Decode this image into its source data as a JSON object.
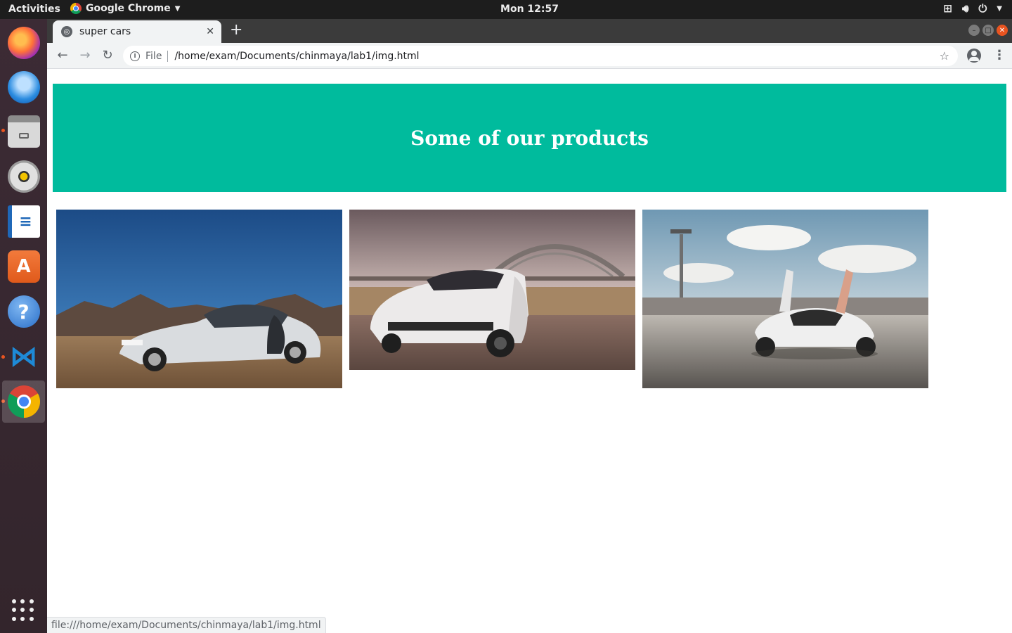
{
  "system_bar": {
    "activities": "Activities",
    "app_name": "Google Chrome",
    "clock": "Mon 12:57"
  },
  "dock": {
    "items": [
      {
        "name": "firefox-icon"
      },
      {
        "name": "thunderbird-icon"
      },
      {
        "name": "files-icon"
      },
      {
        "name": "rhythmbox-icon"
      },
      {
        "name": "libreoffice-writer-icon"
      },
      {
        "name": "ubuntu-software-icon"
      },
      {
        "name": "help-icon"
      },
      {
        "name": "vscode-icon"
      },
      {
        "name": "chrome-icon"
      }
    ]
  },
  "browser": {
    "tab_title": "super cars",
    "address_scheme": "File",
    "address_path": "/home/exam/Documents/chinmaya/lab1/img.html",
    "status_url": "file:///home/exam/Documents/chinmaya/lab1/img.html"
  },
  "page": {
    "heading": "Some of our products",
    "banner_color": "#00bb9d",
    "products": [
      {
        "name": "car-photo-1"
      },
      {
        "name": "car-photo-2"
      },
      {
        "name": "car-photo-3"
      }
    ]
  }
}
